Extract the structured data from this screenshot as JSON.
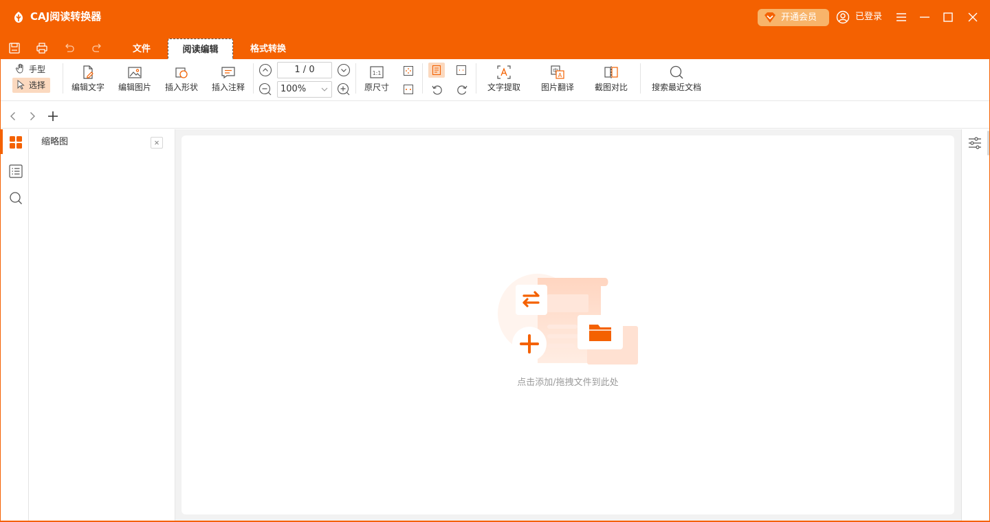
{
  "app": {
    "title": "CAJ阅读转换器"
  },
  "header": {
    "vip_label": "开通会员",
    "login_label": "已登录"
  },
  "menu": {
    "tabs": [
      {
        "label": "文件"
      },
      {
        "label": "阅读编辑"
      },
      {
        "label": "格式转换"
      }
    ]
  },
  "ribbon": {
    "hand_label": "手型",
    "select_label": "选择",
    "edit_text": "编辑文字",
    "edit_image": "编辑图片",
    "insert_shape": "插入形状",
    "insert_note": "插入注释",
    "page_value": "1 / 0",
    "zoom_value": "100%",
    "original_size": "原尺寸",
    "text_extract": "文字提取",
    "image_translate": "图片翻译",
    "screenshot_compare": "截图对比",
    "search_recent": "搜索最近文档"
  },
  "sidebar": {
    "panel_title": "缩略图"
  },
  "canvas": {
    "empty_hint": "点击添加/拖拽文件到此处"
  },
  "colors": {
    "accent": "#F46101",
    "vip": "#F8B46A",
    "selected_bg": "#FBD9BF"
  }
}
